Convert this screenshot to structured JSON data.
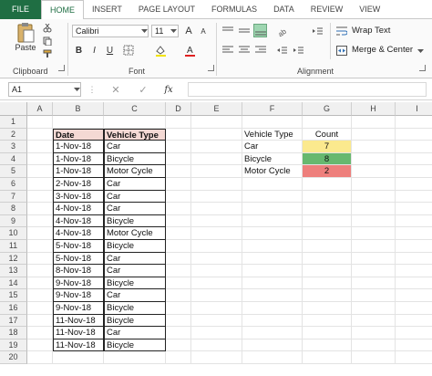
{
  "tabs": [
    "FILE",
    "HOME",
    "INSERT",
    "PAGE LAYOUT",
    "FORMULAS",
    "DATA",
    "REVIEW",
    "VIEW"
  ],
  "ribbon": {
    "paste_label": "Paste",
    "clipboard_label": "Clipboard",
    "font_name": "Calibri",
    "font_size": "11",
    "font_label": "Font",
    "bold": "B",
    "italic": "I",
    "underline": "U",
    "grow_font": "A",
    "shrink_font": "A",
    "wrap_text": "Wrap Text",
    "merge_center": "Merge & Center",
    "alignment_label": "Alignment"
  },
  "formula_bar": {
    "name_box": "A1",
    "fx": "fx",
    "formula": ""
  },
  "columns": [
    "A",
    "B",
    "C",
    "D",
    "E",
    "F",
    "G",
    "H",
    "I"
  ],
  "rows": [
    "1",
    "2",
    "3",
    "4",
    "5",
    "6",
    "7",
    "8",
    "9",
    "10",
    "11",
    "12",
    "13",
    "14",
    "15",
    "16",
    "17",
    "18",
    "19",
    "20"
  ],
  "table": {
    "headers": [
      "Date",
      "Vehicle Type"
    ],
    "rows": [
      [
        "1-Nov-18",
        "Car"
      ],
      [
        "1-Nov-18",
        "Bicycle"
      ],
      [
        "1-Nov-18",
        "Motor Cycle"
      ],
      [
        "2-Nov-18",
        "Car"
      ],
      [
        "3-Nov-18",
        "Car"
      ],
      [
        "4-Nov-18",
        "Car"
      ],
      [
        "4-Nov-18",
        "Bicycle"
      ],
      [
        "4-Nov-18",
        "Motor Cycle"
      ],
      [
        "5-Nov-18",
        "Bicycle"
      ],
      [
        "5-Nov-18",
        "Car"
      ],
      [
        "8-Nov-18",
        "Car"
      ],
      [
        "9-Nov-18",
        "Bicycle"
      ],
      [
        "9-Nov-18",
        "Car"
      ],
      [
        "9-Nov-18",
        "Bicycle"
      ],
      [
        "11-Nov-18",
        "Bicycle"
      ],
      [
        "11-Nov-18",
        "Car"
      ],
      [
        "11-Nov-18",
        "Bicycle"
      ]
    ]
  },
  "summary": {
    "headers": [
      "Vehicle Type",
      "Count"
    ],
    "rows": [
      {
        "type": "Car",
        "count": "7",
        "color": "#fbe98e"
      },
      {
        "type": "Bicycle",
        "count": "8",
        "color": "#67b86f"
      },
      {
        "type": "Motor Cycle",
        "count": "2",
        "color": "#ee7f7c"
      }
    ]
  },
  "colors": {
    "file_tab": "#1f6e43",
    "header_fill": "#f4d9d4"
  }
}
